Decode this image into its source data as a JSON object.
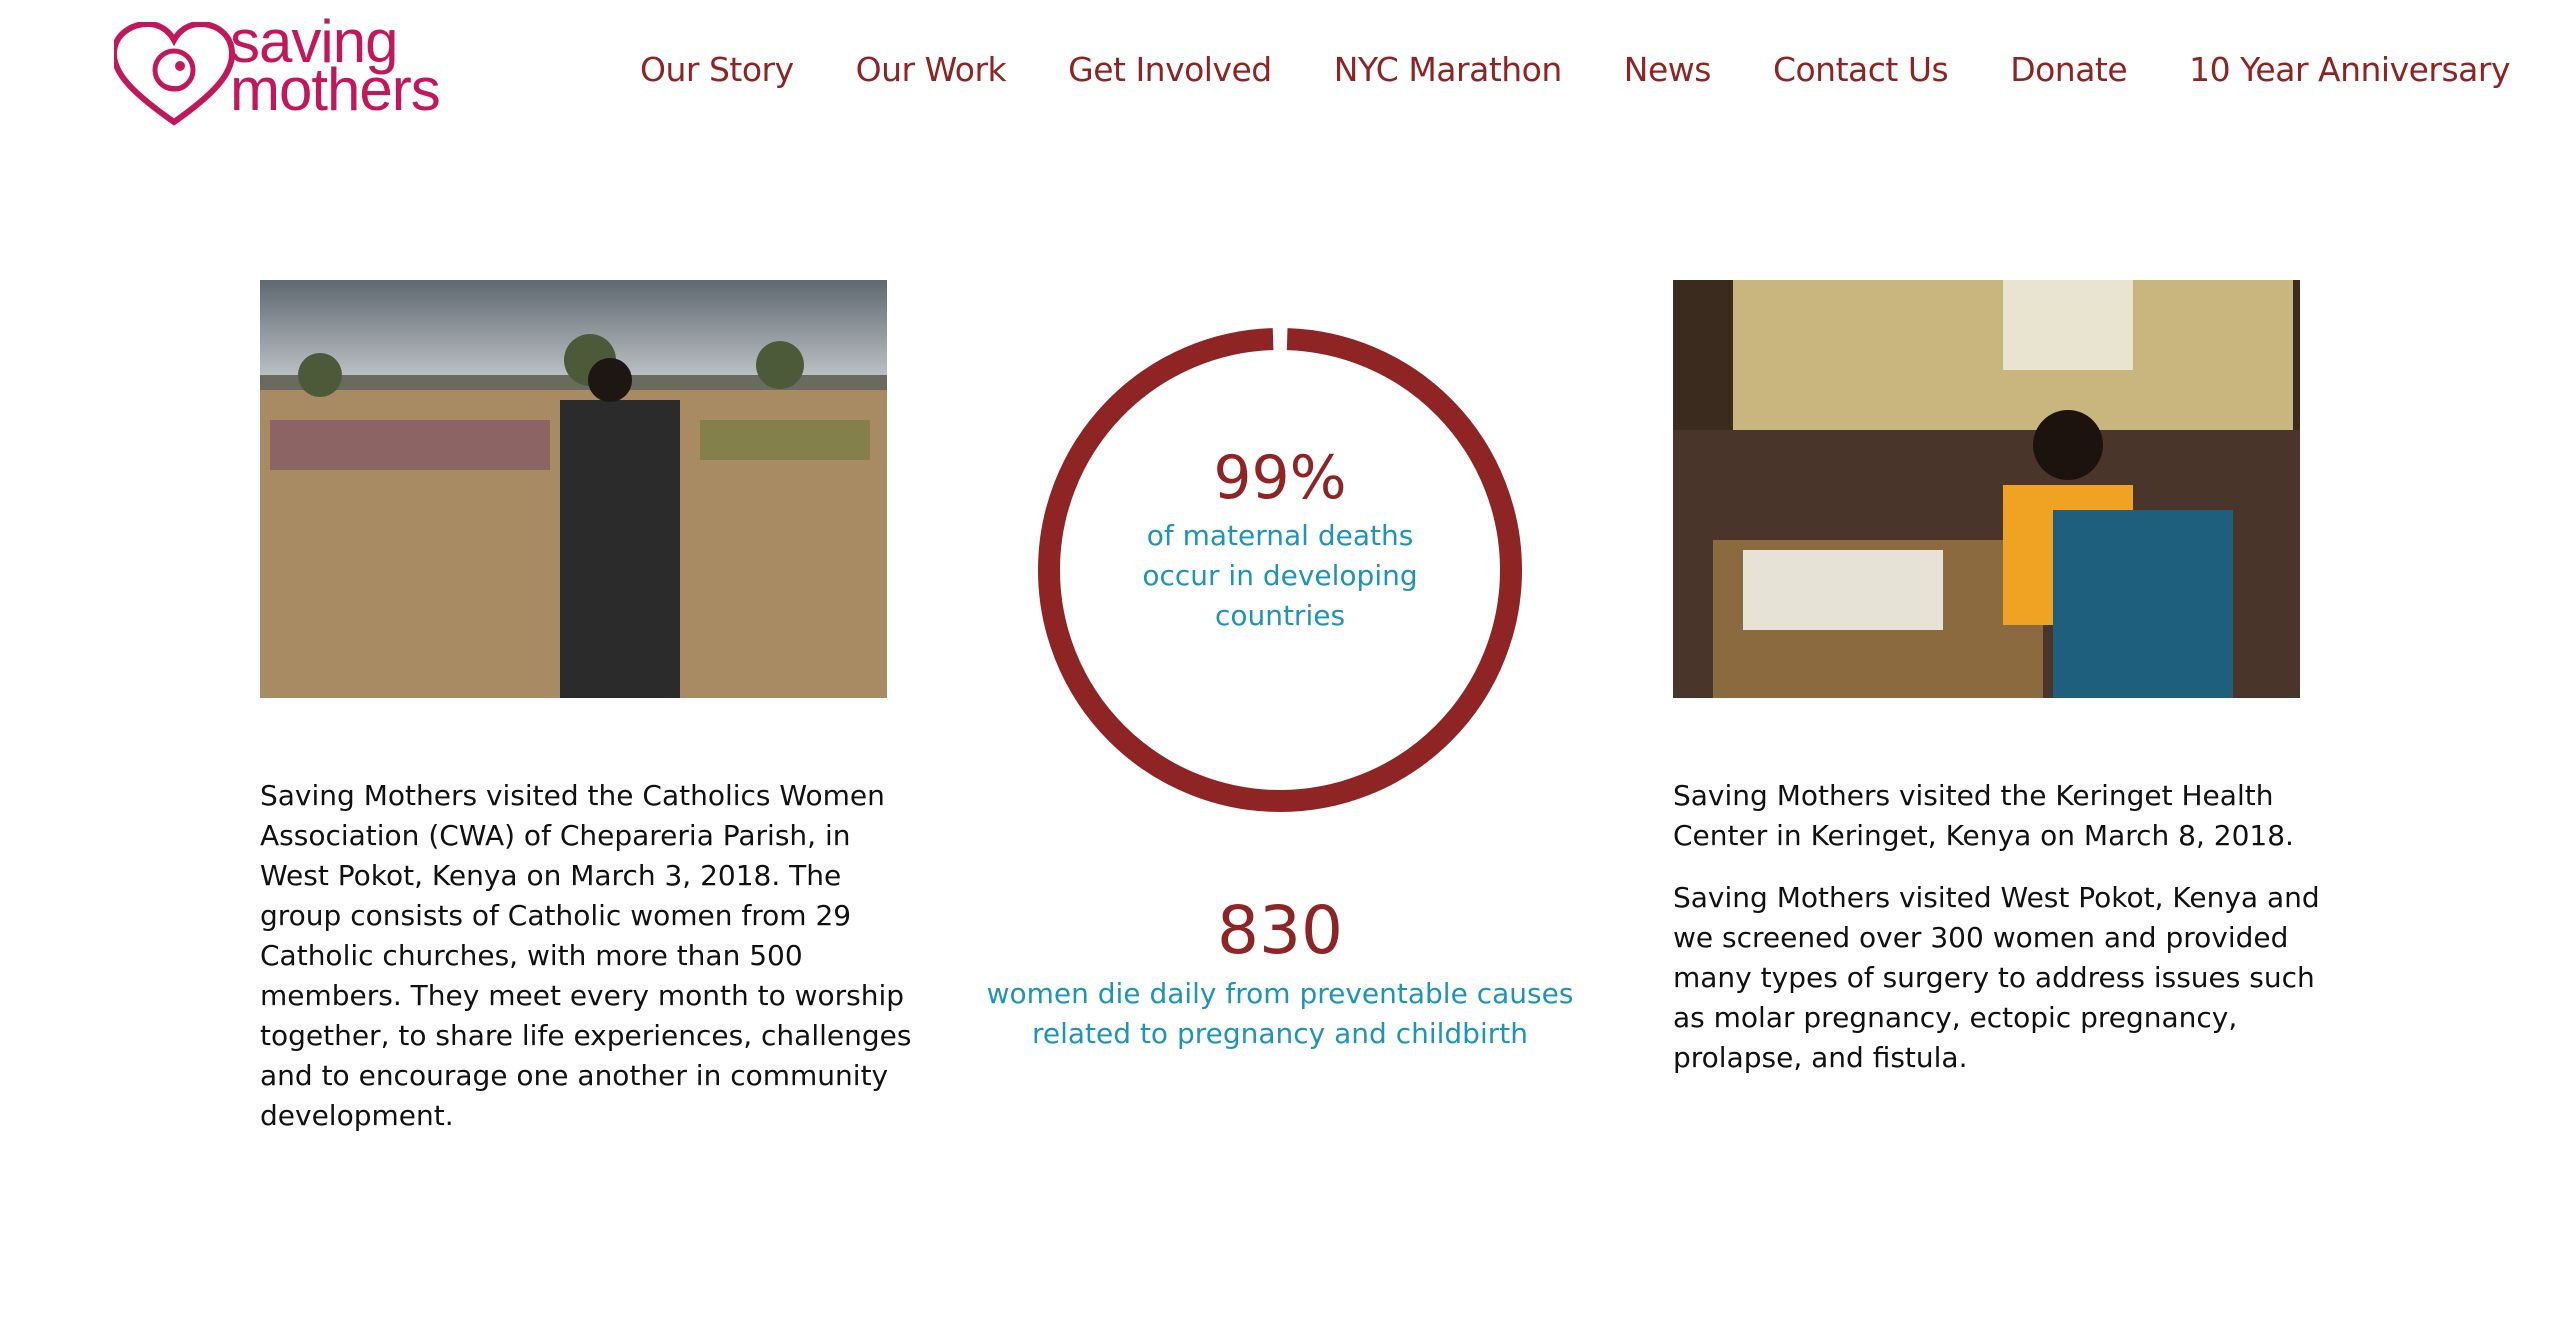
{
  "brand": {
    "logo_line1": "saving",
    "logo_line2": "mothers",
    "color": "#c2185b"
  },
  "nav": {
    "items": [
      {
        "label": "Our Story"
      },
      {
        "label": "Our Work"
      },
      {
        "label": "Get Involved"
      },
      {
        "label": "NYC Marathon"
      },
      {
        "label": "News"
      },
      {
        "label": "Contact Us"
      },
      {
        "label": "Donate"
      },
      {
        "label": "10 Year Anniversary"
      }
    ],
    "color": "#8e2424"
  },
  "left": {
    "photo": "community-meeting-photo",
    "text": "Saving Mothers visited the Catholics Women Association (CWA) of Chepareria Parish, in West Pokot, Kenya on March 3, 2018. The group consists of Catholic women from 29 Catholic churches, with more than 500 members. They meet every month to worship together, to share life experiences, challenges and to encourage one another in community development."
  },
  "center": {
    "ring": {
      "value": "99%",
      "fraction": 0.99,
      "caption": "of maternal deaths occur in developing countries",
      "color": "#8e2424",
      "caption_color": "#1f94b9"
    },
    "stat2": {
      "value": "830",
      "caption": "women die daily from preventable causes related to pregnancy and childbirth"
    }
  },
  "right": {
    "photo": "health-center-photo",
    "paragraphs": [
      "Saving Mothers visited the Keringet Health Center in Keringet, Kenya on March 8, 2018.",
      "Saving Mothers visited West Pokot, Kenya and we screened over 300 women and provided many types of surgery to address issues such as molar pregnancy, ectopic pregnancy, prolapse, and fistula."
    ]
  }
}
